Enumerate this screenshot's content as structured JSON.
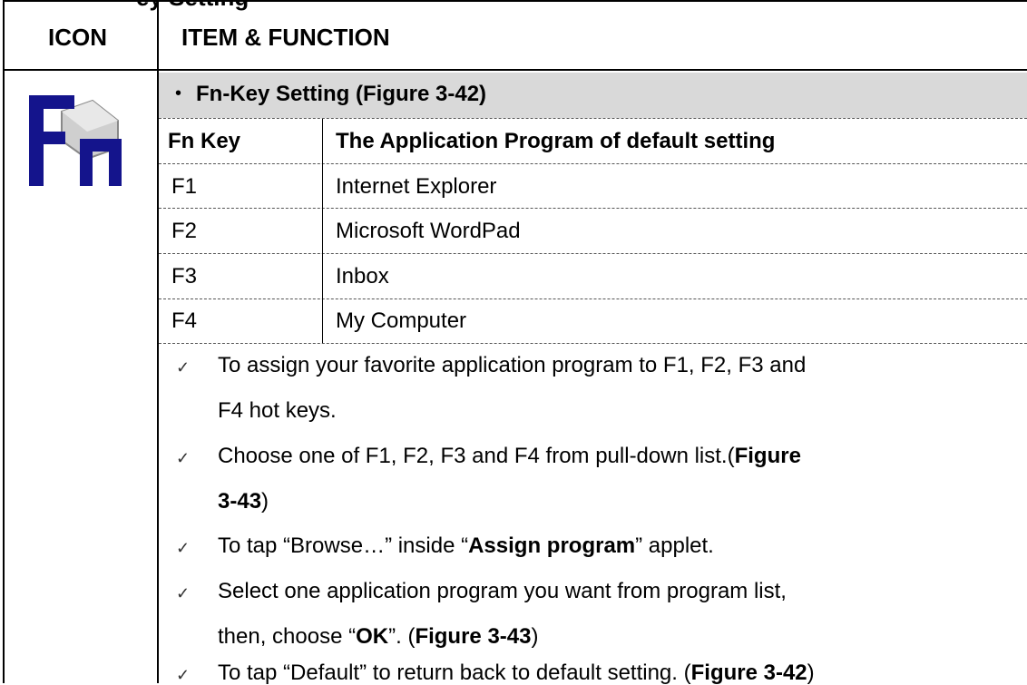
{
  "header": {
    "cut_title_fragment": "ey Setting",
    "icon_col": "ICON",
    "item_col": "ITEM & FUNCTION"
  },
  "section": {
    "bullet": "•",
    "title": "Fn-Key Setting (Figure 3-42)"
  },
  "table": {
    "col1": "Fn Key",
    "col2": "The Application Program of default setting",
    "rows": [
      {
        "key": "F1",
        "program": "Internet Explorer"
      },
      {
        "key": "F2",
        "program": "Microsoft WordPad"
      },
      {
        "key": "F3",
        "program": "Inbox"
      },
      {
        "key": "F4",
        "program": "My Computer"
      }
    ]
  },
  "steps": {
    "check": "✓",
    "s1_l1": "To assign your favorite application program to F1, F2, F3 and",
    "s1_l2": "F4 hot keys.",
    "s2_l1a": "Choose one of F1, F2, F3 and F4 from pull-down list.(",
    "s2_l1b": "Figure",
    "s2_l2a": "3-43",
    "s2_l2b": ")",
    "s3_a": "To tap “Browse…” inside “",
    "s3_b": "Assign program",
    "s3_c": "” applet.",
    "s4_l1": "Select one application program you want from program list,",
    "s4_l2a": "then, choose “",
    "s4_l2b": "OK",
    "s4_l2c": "”. (",
    "s4_l2d": "Figure 3-43",
    "s4_l2e": ")",
    "s5_a": "To tap “Default” to return back to default setting. (",
    "s5_b": "Figure 3-42",
    "s5_c": ")"
  },
  "icon": {
    "name": "fn-key-icon",
    "colors": {
      "letters": "#14148c",
      "accent": "#c0c0c0"
    }
  }
}
